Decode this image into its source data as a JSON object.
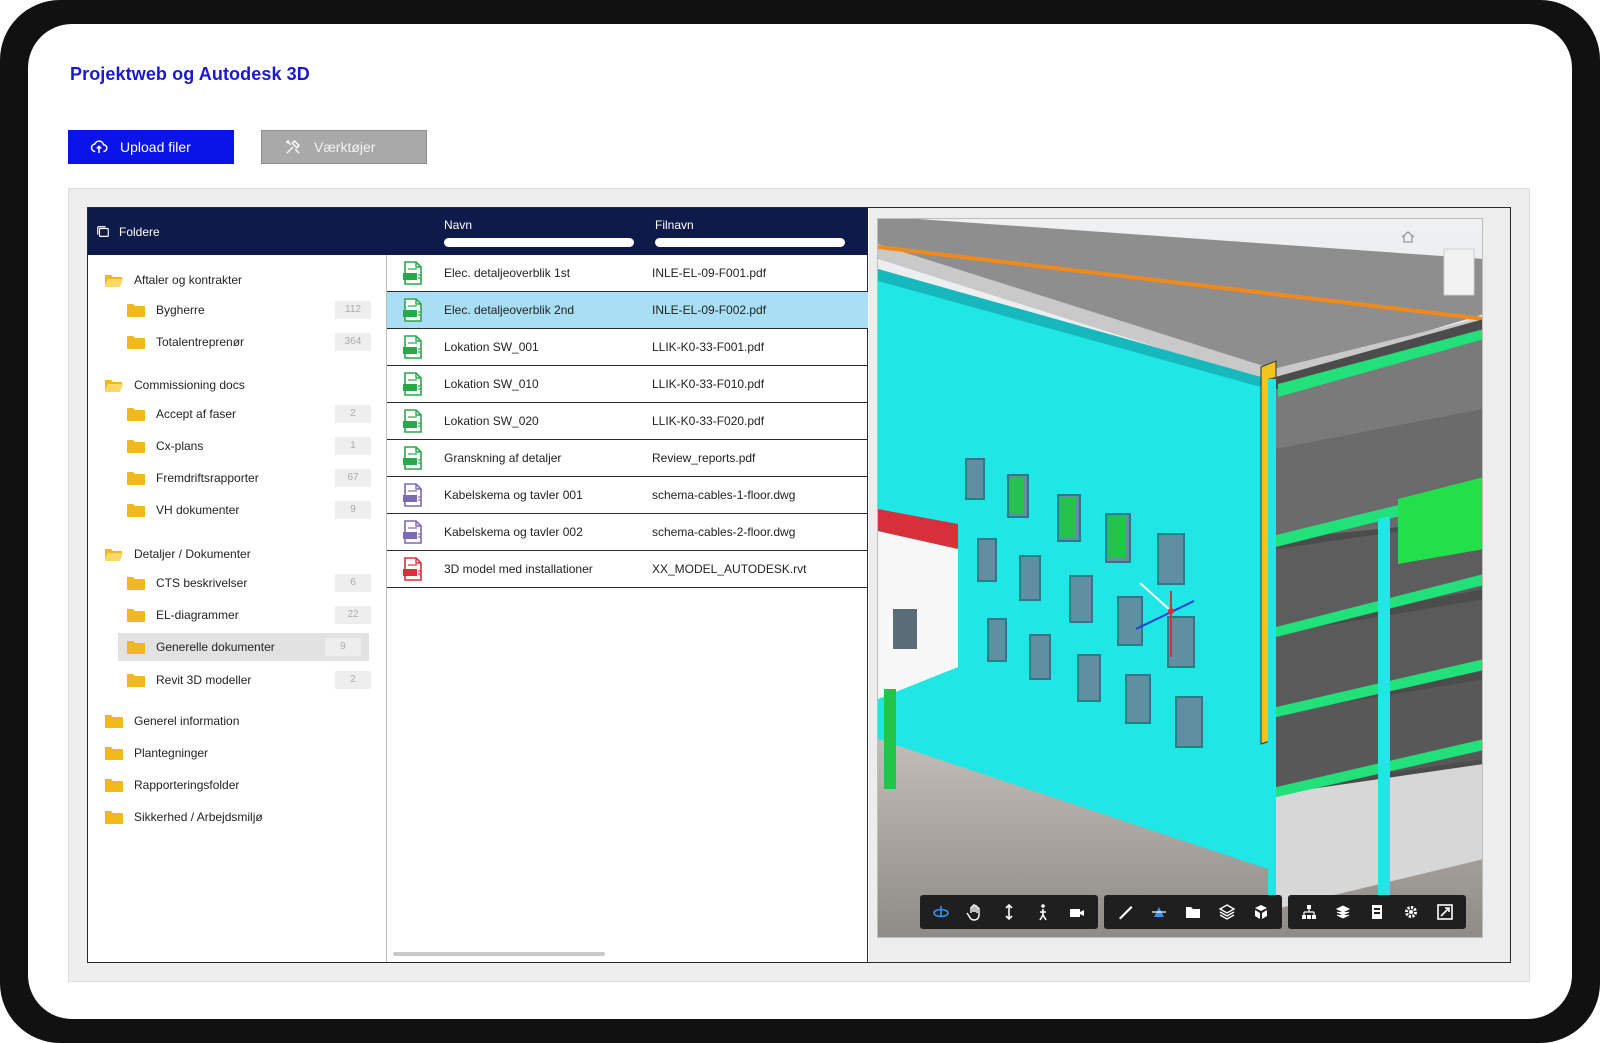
{
  "app": {
    "title": "Projektweb og Autodesk 3D"
  },
  "buttons": {
    "upload": "Upload filer",
    "tools": "Værktøjer"
  },
  "header": {
    "folders": "Foldere",
    "col_name": "Navn",
    "col_filename": "Filnavn"
  },
  "tree": [
    {
      "label": "Aftaler og kontrakter",
      "level": 0,
      "open": true
    },
    {
      "label": "Bygherre",
      "level": 1,
      "count": "112"
    },
    {
      "label": "Totalentreprenør",
      "level": 1,
      "count": "364"
    },
    {
      "label": "Commissioning docs",
      "level": 0,
      "open": true
    },
    {
      "label": "Accept af faser",
      "level": 1,
      "count": "2"
    },
    {
      "label": "Cx-plans",
      "level": 1,
      "count": "1"
    },
    {
      "label": "Fremdriftsrapporter",
      "level": 1,
      "count": "67"
    },
    {
      "label": "VH dokumenter",
      "level": 1,
      "count": "9"
    },
    {
      "label": "Detaljer / Dokumenter",
      "level": 0,
      "open": true
    },
    {
      "label": "CTS beskrivelser",
      "level": 1,
      "count": "6"
    },
    {
      "label": "EL-diagrammer",
      "level": 1,
      "count": "22"
    },
    {
      "label": "Generelle dokumenter",
      "level": 1,
      "count": "9",
      "selected": true
    },
    {
      "label": "Revit 3D modeller",
      "level": 1,
      "count": "2"
    },
    {
      "label": "Generel information",
      "level": 0
    },
    {
      "label": "Plantegninger",
      "level": 0
    },
    {
      "label": "Rapporteringsfolder",
      "level": 0
    },
    {
      "label": "Sikkerhed / Arbejdsmiljø",
      "level": 0
    }
  ],
  "files": [
    {
      "name": "Elec. detaljeoverblik 1st",
      "file": "INLE-EL-09-F001.pdf",
      "type": "pdf"
    },
    {
      "name": "Elec. detaljeoverblik 2nd",
      "file": "INLE-EL-09-F002.pdf",
      "type": "pdf",
      "active": true
    },
    {
      "name": "Lokation SW_001",
      "file": "LLIK-K0-33-F001.pdf",
      "type": "pdf"
    },
    {
      "name": "Lokation SW_010",
      "file": "LLIK-K0-33-F010.pdf",
      "type": "pdf"
    },
    {
      "name": "Lokation SW_020",
      "file": "LLIK-K0-33-F020.pdf",
      "type": "pdf"
    },
    {
      "name": "Granskning af detaljer",
      "file": "Review_reports.pdf",
      "type": "pdf"
    },
    {
      "name": "Kabelskema og tavler 001",
      "file": "schema-cables-1-floor.dwg",
      "type": "dwg"
    },
    {
      "name": "Kabelskema og tavler 002",
      "file": "schema-cables-2-floor.dwg",
      "type": "dwg"
    },
    {
      "name": "3D model med installationer",
      "file": "XX_MODEL_AUTODESK.rvt",
      "type": "rvt"
    }
  ],
  "viewer": {
    "toolbar_groups": [
      [
        "orbit-icon",
        "pan-icon",
        "zoom-icon",
        "walk-icon",
        "camera-icon"
      ],
      [
        "measure-icon",
        "section-icon",
        "folder-icon",
        "layers-icon",
        "explode-icon"
      ],
      [
        "model-browser-icon",
        "properties-icon",
        "document-icon",
        "settings-icon",
        "fullscreen-icon"
      ]
    ]
  },
  "colors": {
    "accent": "#0a14e8",
    "header": "#0d1a4a",
    "selected_row": "#a8dff5",
    "folder": "#f0b81c",
    "pdf": "#27a84a",
    "dwg": "#7b6bb0",
    "rvt": "#d8303a"
  }
}
